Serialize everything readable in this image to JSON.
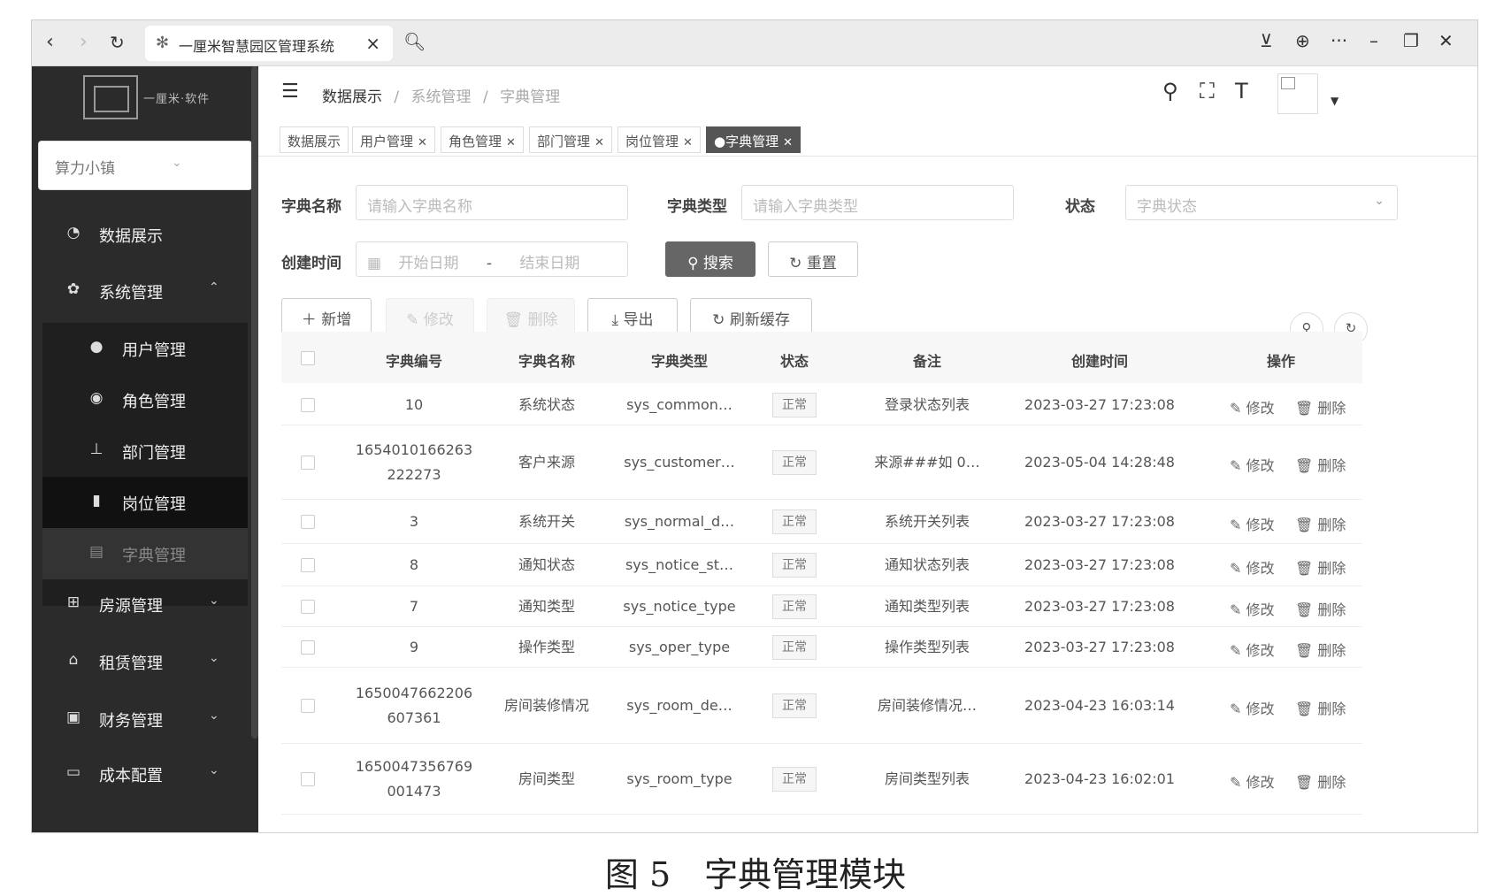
{
  "browser": {
    "tab_title": "一厘米智慧园区管理系统",
    "tab_close": "×"
  },
  "sidebar": {
    "brand": "一厘米·软件",
    "town_selector": "算力小镇",
    "menu": [
      {
        "label": "数据展示",
        "icon": "dashboard-icon"
      },
      {
        "label": "系统管理",
        "icon": "gear-icon",
        "expanded": true
      },
      {
        "label": "房源管理",
        "icon": "grid-icon"
      },
      {
        "label": "租赁管理",
        "icon": "building-icon"
      },
      {
        "label": "财务管理",
        "icon": "finance-icon"
      },
      {
        "label": "成本配置",
        "icon": "config-icon"
      }
    ],
    "submenu": [
      {
        "label": "用户管理",
        "icon": "user-icon"
      },
      {
        "label": "角色管理",
        "icon": "role-icon"
      },
      {
        "label": "部门管理",
        "icon": "org-icon"
      },
      {
        "label": "岗位管理",
        "icon": "post-icon"
      },
      {
        "label": "字典管理",
        "icon": "dict-icon"
      }
    ]
  },
  "header": {
    "breadcrumb": [
      "数据展示",
      "/",
      "系统管理",
      "/",
      "字典管理"
    ]
  },
  "tags": [
    {
      "label": "数据展示",
      "closable": false
    },
    {
      "label": "用户管理",
      "closable": true
    },
    {
      "label": "角色管理",
      "closable": true
    },
    {
      "label": "部门管理",
      "closable": true
    },
    {
      "label": "岗位管理",
      "closable": true
    },
    {
      "label": "●字典管理",
      "closable": true,
      "active": true
    }
  ],
  "filters": {
    "name_label": "字典名称",
    "name_placeholder": "请输入字典名称",
    "type_label": "字典类型",
    "type_placeholder": "请输入字典类型",
    "status_label": "状态",
    "status_placeholder": "字典状态",
    "time_label": "创建时间",
    "start_placeholder": "开始日期",
    "range_sep": "-",
    "end_placeholder": "结束日期",
    "search_btn": "搜索",
    "reset_btn": "重置"
  },
  "toolbar": {
    "add": "新增",
    "edit": "修改",
    "delete": "删除",
    "export": "导出",
    "refresh_cache": "刷新缓存"
  },
  "table": {
    "headers": [
      "字典编号",
      "字典名称",
      "字典类型",
      "状态",
      "备注",
      "创建时间",
      "操作"
    ],
    "edit_label": "修改",
    "delete_label": "删除",
    "rows": [
      {
        "id": "10",
        "name": "系统状态",
        "type": "sys_common…",
        "status": "正常",
        "remark": "登录状态列表",
        "time": "2023-03-27 17:23:08"
      },
      {
        "id": "1654010166263\n222273",
        "name": "客户来源",
        "type": "sys_customer…",
        "status": "正常",
        "remark": "来源###如 0…",
        "time": "2023-05-04 14:28:48"
      },
      {
        "id": "3",
        "name": "系统开关",
        "type": "sys_normal_d…",
        "status": "正常",
        "remark": "系统开关列表",
        "time": "2023-03-27 17:23:08"
      },
      {
        "id": "8",
        "name": "通知状态",
        "type": "sys_notice_st…",
        "status": "正常",
        "remark": "通知状态列表",
        "time": "2023-03-27 17:23:08"
      },
      {
        "id": "7",
        "name": "通知类型",
        "type": "sys_notice_type",
        "status": "正常",
        "remark": "通知类型列表",
        "time": "2023-03-27 17:23:08"
      },
      {
        "id": "9",
        "name": "操作类型",
        "type": "sys_oper_type",
        "status": "正常",
        "remark": "操作类型列表",
        "time": "2023-03-27 17:23:08"
      },
      {
        "id": "1650047662206\n607361",
        "name": "房间装修情况",
        "type": "sys_room_de…",
        "status": "正常",
        "remark": "房间装修情况…",
        "time": "2023-04-23 16:03:14"
      },
      {
        "id": "1650047356769\n001473",
        "name": "房间类型",
        "type": "sys_room_type",
        "status": "正常",
        "remark": "房间类型列表",
        "time": "2023-04-23 16:02:01"
      }
    ]
  },
  "caption": "图 5　字典管理模块"
}
